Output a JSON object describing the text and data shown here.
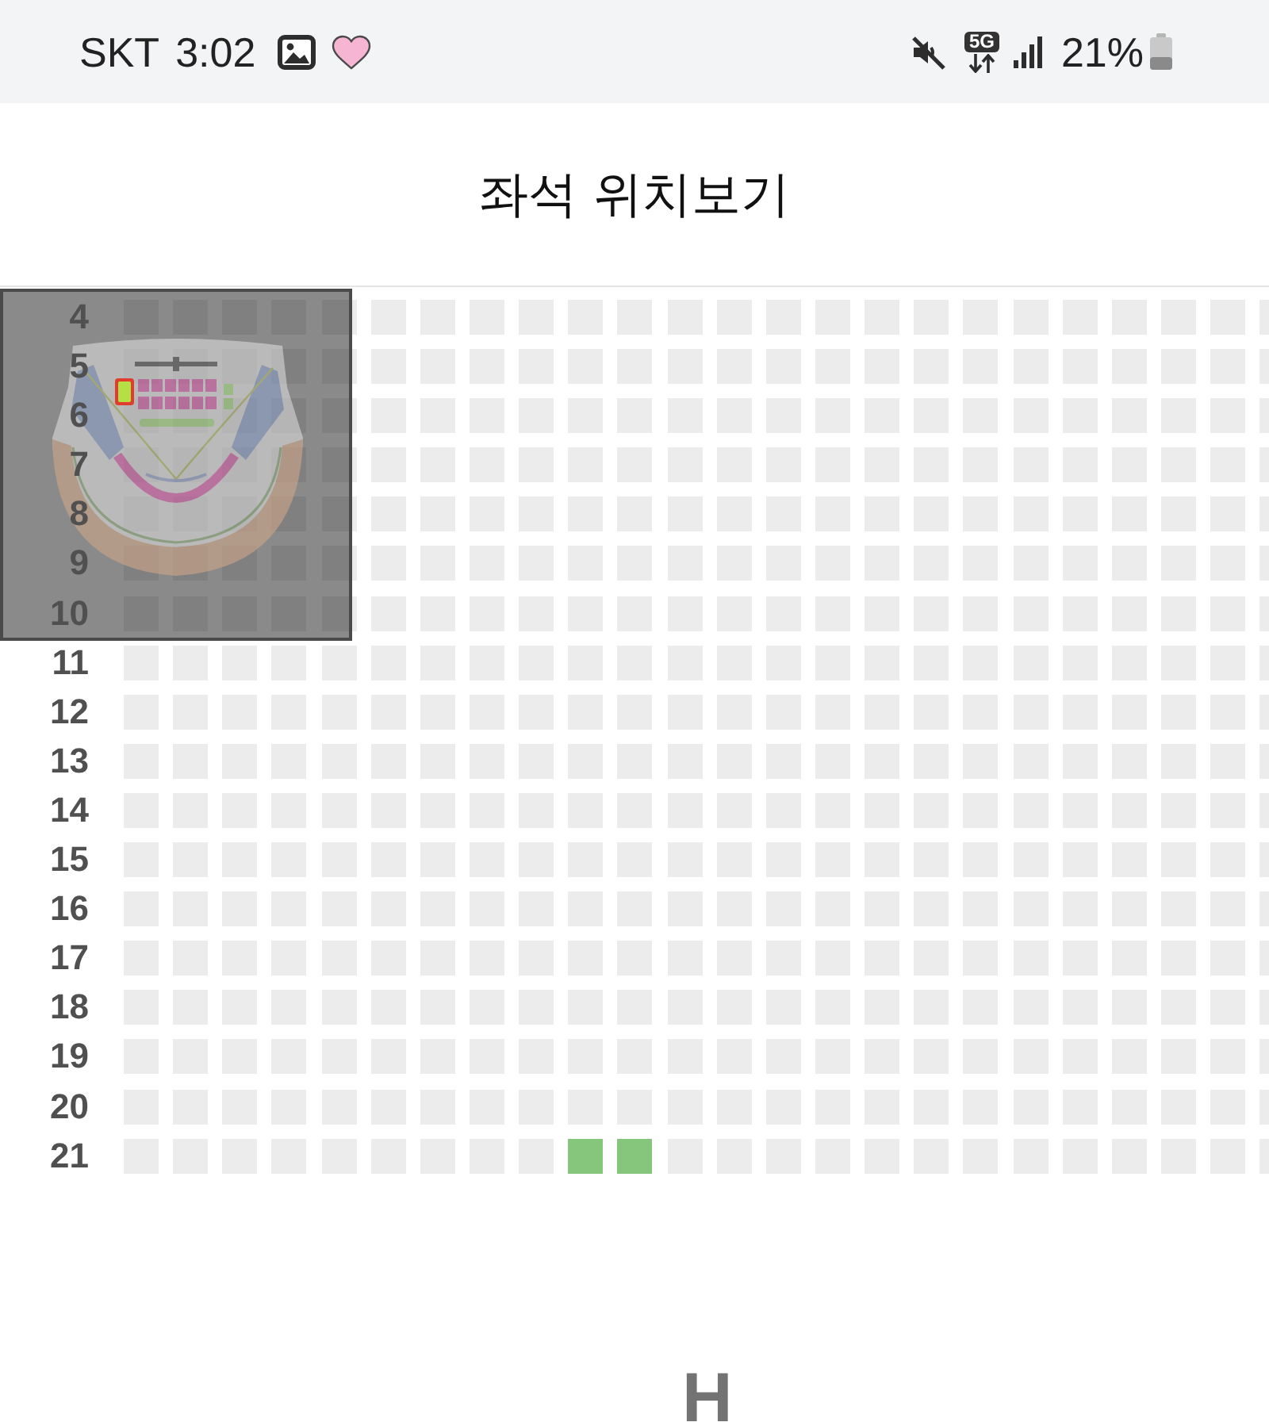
{
  "status_bar": {
    "carrier": "SKT",
    "time": "3:02",
    "network": "5G",
    "battery": "21%"
  },
  "header": {
    "title": "좌석 위치보기"
  },
  "seat_map": {
    "rows": [
      {
        "label": "4",
        "seats": [
          {
            "selected": false
          },
          {
            "selected": false
          },
          {
            "selected": false
          },
          {
            "selected": false
          },
          {
            "selected": false
          },
          {
            "selected": false
          },
          {
            "selected": false
          },
          {
            "selected": false
          },
          {
            "selected": false
          },
          {
            "selected": false
          },
          {
            "selected": false
          },
          {
            "selected": false
          },
          {
            "selected": false
          },
          {
            "selected": false
          },
          {
            "selected": false
          },
          {
            "selected": false
          },
          {
            "selected": false
          },
          {
            "selected": false
          },
          {
            "selected": false
          },
          {
            "selected": false
          },
          {
            "selected": false
          },
          {
            "selected": false
          },
          {
            "selected": false
          },
          {
            "selected": false
          }
        ]
      },
      {
        "label": "5",
        "seats": [
          {
            "selected": false
          },
          {
            "selected": false
          },
          {
            "selected": false
          },
          {
            "selected": false
          },
          {
            "selected": false
          },
          {
            "selected": false
          },
          {
            "selected": false
          },
          {
            "selected": false
          },
          {
            "selected": false
          },
          {
            "selected": false
          },
          {
            "selected": false
          },
          {
            "selected": false
          },
          {
            "selected": false
          },
          {
            "selected": false
          },
          {
            "selected": false
          },
          {
            "selected": false
          },
          {
            "selected": false
          },
          {
            "selected": false
          },
          {
            "selected": false
          },
          {
            "selected": false
          },
          {
            "selected": false
          },
          {
            "selected": false
          },
          {
            "selected": false
          },
          {
            "selected": false
          }
        ]
      },
      {
        "label": "6",
        "seats": [
          {
            "selected": false
          },
          {
            "selected": false
          },
          {
            "selected": false
          },
          {
            "selected": false
          },
          {
            "selected": false
          },
          {
            "selected": false
          },
          {
            "selected": false
          },
          {
            "selected": false
          },
          {
            "selected": false
          },
          {
            "selected": false
          },
          {
            "selected": false
          },
          {
            "selected": false
          },
          {
            "selected": false
          },
          {
            "selected": false
          },
          {
            "selected": false
          },
          {
            "selected": false
          },
          {
            "selected": false
          },
          {
            "selected": false
          },
          {
            "selected": false
          },
          {
            "selected": false
          },
          {
            "selected": false
          },
          {
            "selected": false
          },
          {
            "selected": false
          },
          {
            "selected": false
          }
        ]
      },
      {
        "label": "7",
        "seats": [
          {
            "selected": false
          },
          {
            "selected": false
          },
          {
            "selected": false
          },
          {
            "selected": false
          },
          {
            "selected": false
          },
          {
            "selected": false
          },
          {
            "selected": false
          },
          {
            "selected": false
          },
          {
            "selected": false
          },
          {
            "selected": false
          },
          {
            "selected": false
          },
          {
            "selected": false
          },
          {
            "selected": false
          },
          {
            "selected": false
          },
          {
            "selected": false
          },
          {
            "selected": false
          },
          {
            "selected": false
          },
          {
            "selected": false
          },
          {
            "selected": false
          },
          {
            "selected": false
          },
          {
            "selected": false
          },
          {
            "selected": false
          },
          {
            "selected": false
          },
          {
            "selected": false
          }
        ]
      },
      {
        "label": "8",
        "seats": [
          {
            "selected": false
          },
          {
            "selected": false
          },
          {
            "selected": false
          },
          {
            "selected": false
          },
          {
            "selected": false
          },
          {
            "selected": false
          },
          {
            "selected": false
          },
          {
            "selected": false
          },
          {
            "selected": false
          },
          {
            "selected": false
          },
          {
            "selected": false
          },
          {
            "selected": false
          },
          {
            "selected": false
          },
          {
            "selected": false
          },
          {
            "selected": false
          },
          {
            "selected": false
          },
          {
            "selected": false
          },
          {
            "selected": false
          },
          {
            "selected": false
          },
          {
            "selected": false
          },
          {
            "selected": false
          },
          {
            "selected": false
          },
          {
            "selected": false
          },
          {
            "selected": false
          }
        ]
      },
      {
        "label": "9",
        "seats": [
          {
            "selected": false
          },
          {
            "selected": false
          },
          {
            "selected": false
          },
          {
            "selected": false
          },
          {
            "selected": false
          },
          {
            "selected": false
          },
          {
            "selected": false
          },
          {
            "selected": false
          },
          {
            "selected": false
          },
          {
            "selected": false
          },
          {
            "selected": false
          },
          {
            "selected": false
          },
          {
            "selected": false
          },
          {
            "selected": false
          },
          {
            "selected": false
          },
          {
            "selected": false
          },
          {
            "selected": false
          },
          {
            "selected": false
          },
          {
            "selected": false
          },
          {
            "selected": false
          },
          {
            "selected": false
          },
          {
            "selected": false
          },
          {
            "selected": false
          },
          {
            "selected": false
          }
        ]
      },
      {
        "label": "10",
        "seats": [
          {
            "selected": false
          },
          {
            "selected": false
          },
          {
            "selected": false
          },
          {
            "selected": false
          },
          {
            "selected": false
          },
          {
            "selected": false
          },
          {
            "selected": false
          },
          {
            "selected": false
          },
          {
            "selected": false
          },
          {
            "selected": false
          },
          {
            "selected": false
          },
          {
            "selected": false
          },
          {
            "selected": false
          },
          {
            "selected": false
          },
          {
            "selected": false
          },
          {
            "selected": false
          },
          {
            "selected": false
          },
          {
            "selected": false
          },
          {
            "selected": false
          },
          {
            "selected": false
          },
          {
            "selected": false
          },
          {
            "selected": false
          },
          {
            "selected": false
          },
          {
            "selected": false
          }
        ]
      },
      {
        "label": "11",
        "seats": [
          {
            "selected": false
          },
          {
            "selected": false
          },
          {
            "selected": false
          },
          {
            "selected": false
          },
          {
            "selected": false
          },
          {
            "selected": false
          },
          {
            "selected": false
          },
          {
            "selected": false
          },
          {
            "selected": false
          },
          {
            "selected": false
          },
          {
            "selected": false
          },
          {
            "selected": false
          },
          {
            "selected": false
          },
          {
            "selected": false
          },
          {
            "selected": false
          },
          {
            "selected": false
          },
          {
            "selected": false
          },
          {
            "selected": false
          },
          {
            "selected": false
          },
          {
            "selected": false
          },
          {
            "selected": false
          },
          {
            "selected": false
          },
          {
            "selected": false
          },
          {
            "selected": false
          }
        ]
      },
      {
        "label": "12",
        "seats": [
          {
            "selected": false
          },
          {
            "selected": false
          },
          {
            "selected": false
          },
          {
            "selected": false
          },
          {
            "selected": false
          },
          {
            "selected": false
          },
          {
            "selected": false
          },
          {
            "selected": false
          },
          {
            "selected": false
          },
          {
            "selected": false
          },
          {
            "selected": false
          },
          {
            "selected": false
          },
          {
            "selected": false
          },
          {
            "selected": false
          },
          {
            "selected": false
          },
          {
            "selected": false
          },
          {
            "selected": false
          },
          {
            "selected": false
          },
          {
            "selected": false
          },
          {
            "selected": false
          },
          {
            "selected": false
          },
          {
            "selected": false
          },
          {
            "selected": false
          },
          {
            "selected": false
          }
        ]
      },
      {
        "label": "13",
        "seats": [
          {
            "selected": false
          },
          {
            "selected": false
          },
          {
            "selected": false
          },
          {
            "selected": false
          },
          {
            "selected": false
          },
          {
            "selected": false
          },
          {
            "selected": false
          },
          {
            "selected": false
          },
          {
            "selected": false
          },
          {
            "selected": false
          },
          {
            "selected": false
          },
          {
            "selected": false
          },
          {
            "selected": false
          },
          {
            "selected": false
          },
          {
            "selected": false
          },
          {
            "selected": false
          },
          {
            "selected": false
          },
          {
            "selected": false
          },
          {
            "selected": false
          },
          {
            "selected": false
          },
          {
            "selected": false
          },
          {
            "selected": false
          },
          {
            "selected": false
          },
          {
            "selected": false
          }
        ]
      },
      {
        "label": "14",
        "seats": [
          {
            "selected": false
          },
          {
            "selected": false
          },
          {
            "selected": false
          },
          {
            "selected": false
          },
          {
            "selected": false
          },
          {
            "selected": false
          },
          {
            "selected": false
          },
          {
            "selected": false
          },
          {
            "selected": false
          },
          {
            "selected": false
          },
          {
            "selected": false
          },
          {
            "selected": false
          },
          {
            "selected": false
          },
          {
            "selected": false
          },
          {
            "selected": false
          },
          {
            "selected": false
          },
          {
            "selected": false
          },
          {
            "selected": false
          },
          {
            "selected": false
          },
          {
            "selected": false
          },
          {
            "selected": false
          },
          {
            "selected": false
          },
          {
            "selected": false
          },
          {
            "selected": false
          }
        ]
      },
      {
        "label": "15",
        "seats": [
          {
            "selected": false
          },
          {
            "selected": false
          },
          {
            "selected": false
          },
          {
            "selected": false
          },
          {
            "selected": false
          },
          {
            "selected": false
          },
          {
            "selected": false
          },
          {
            "selected": false
          },
          {
            "selected": false
          },
          {
            "selected": false
          },
          {
            "selected": false
          },
          {
            "selected": false
          },
          {
            "selected": false
          },
          {
            "selected": false
          },
          {
            "selected": false
          },
          {
            "selected": false
          },
          {
            "selected": false
          },
          {
            "selected": false
          },
          {
            "selected": false
          },
          {
            "selected": false
          },
          {
            "selected": false
          },
          {
            "selected": false
          },
          {
            "selected": false
          },
          {
            "selected": false
          }
        ]
      },
      {
        "label": "16",
        "seats": [
          {
            "selected": false
          },
          {
            "selected": false
          },
          {
            "selected": false
          },
          {
            "selected": false
          },
          {
            "selected": false
          },
          {
            "selected": false
          },
          {
            "selected": false
          },
          {
            "selected": false
          },
          {
            "selected": false
          },
          {
            "selected": false
          },
          {
            "selected": false
          },
          {
            "selected": false
          },
          {
            "selected": false
          },
          {
            "selected": false
          },
          {
            "selected": false
          },
          {
            "selected": false
          },
          {
            "selected": false
          },
          {
            "selected": false
          },
          {
            "selected": false
          },
          {
            "selected": false
          },
          {
            "selected": false
          },
          {
            "selected": false
          },
          {
            "selected": false
          },
          {
            "selected": false
          }
        ]
      },
      {
        "label": "17",
        "seats": [
          {
            "selected": false
          },
          {
            "selected": false
          },
          {
            "selected": false
          },
          {
            "selected": false
          },
          {
            "selected": false
          },
          {
            "selected": false
          },
          {
            "selected": false
          },
          {
            "selected": false
          },
          {
            "selected": false
          },
          {
            "selected": false
          },
          {
            "selected": false
          },
          {
            "selected": false
          },
          {
            "selected": false
          },
          {
            "selected": false
          },
          {
            "selected": false
          },
          {
            "selected": false
          },
          {
            "selected": false
          },
          {
            "selected": false
          },
          {
            "selected": false
          },
          {
            "selected": false
          },
          {
            "selected": false
          },
          {
            "selected": false
          },
          {
            "selected": false
          },
          {
            "selected": false
          }
        ]
      },
      {
        "label": "18",
        "seats": [
          {
            "selected": false
          },
          {
            "selected": false
          },
          {
            "selected": false
          },
          {
            "selected": false
          },
          {
            "selected": false
          },
          {
            "selected": false
          },
          {
            "selected": false
          },
          {
            "selected": false
          },
          {
            "selected": false
          },
          {
            "selected": false
          },
          {
            "selected": false
          },
          {
            "selected": false
          },
          {
            "selected": false
          },
          {
            "selected": false
          },
          {
            "selected": false
          },
          {
            "selected": false
          },
          {
            "selected": false
          },
          {
            "selected": false
          },
          {
            "selected": false
          },
          {
            "selected": false
          },
          {
            "selected": false
          },
          {
            "selected": false
          },
          {
            "selected": false
          },
          {
            "selected": false
          }
        ]
      },
      {
        "label": "19",
        "seats": [
          {
            "selected": false
          },
          {
            "selected": false
          },
          {
            "selected": false
          },
          {
            "selected": false
          },
          {
            "selected": false
          },
          {
            "selected": false
          },
          {
            "selected": false
          },
          {
            "selected": false
          },
          {
            "selected": false
          },
          {
            "selected": false
          },
          {
            "selected": false
          },
          {
            "selected": false
          },
          {
            "selected": false
          },
          {
            "selected": false
          },
          {
            "selected": false
          },
          {
            "selected": false
          },
          {
            "selected": false
          },
          {
            "selected": false
          },
          {
            "selected": false
          },
          {
            "selected": false
          },
          {
            "selected": false
          },
          {
            "selected": false
          },
          {
            "selected": false
          },
          {
            "selected": false
          }
        ]
      },
      {
        "label": "20",
        "seats": [
          {
            "selected": false
          },
          {
            "selected": false
          },
          {
            "selected": false
          },
          {
            "selected": false
          },
          {
            "selected": false
          },
          {
            "selected": false
          },
          {
            "selected": false
          },
          {
            "selected": false
          },
          {
            "selected": false
          },
          {
            "selected": false
          },
          {
            "selected": false
          },
          {
            "selected": false
          },
          {
            "selected": false
          },
          {
            "selected": false
          },
          {
            "selected": false
          },
          {
            "selected": false
          },
          {
            "selected": false
          },
          {
            "selected": false
          },
          {
            "selected": false
          },
          {
            "selected": false
          },
          {
            "selected": false
          },
          {
            "selected": false
          },
          {
            "selected": false
          },
          {
            "selected": false
          }
        ]
      },
      {
        "label": "21",
        "seats": [
          {
            "selected": false
          },
          {
            "selected": false
          },
          {
            "selected": false
          },
          {
            "selected": false
          },
          {
            "selected": false
          },
          {
            "selected": false
          },
          {
            "selected": false
          },
          {
            "selected": false
          },
          {
            "selected": false
          },
          {
            "selected": true
          },
          {
            "selected": true
          },
          {
            "selected": false
          },
          {
            "selected": false
          },
          {
            "selected": false
          },
          {
            "selected": false
          },
          {
            "selected": false
          },
          {
            "selected": false
          },
          {
            "selected": false
          },
          {
            "selected": false
          },
          {
            "selected": false
          },
          {
            "selected": false
          },
          {
            "selected": false
          },
          {
            "selected": false
          },
          {
            "selected": false
          }
        ]
      }
    ]
  },
  "footer": {
    "section": "H"
  }
}
